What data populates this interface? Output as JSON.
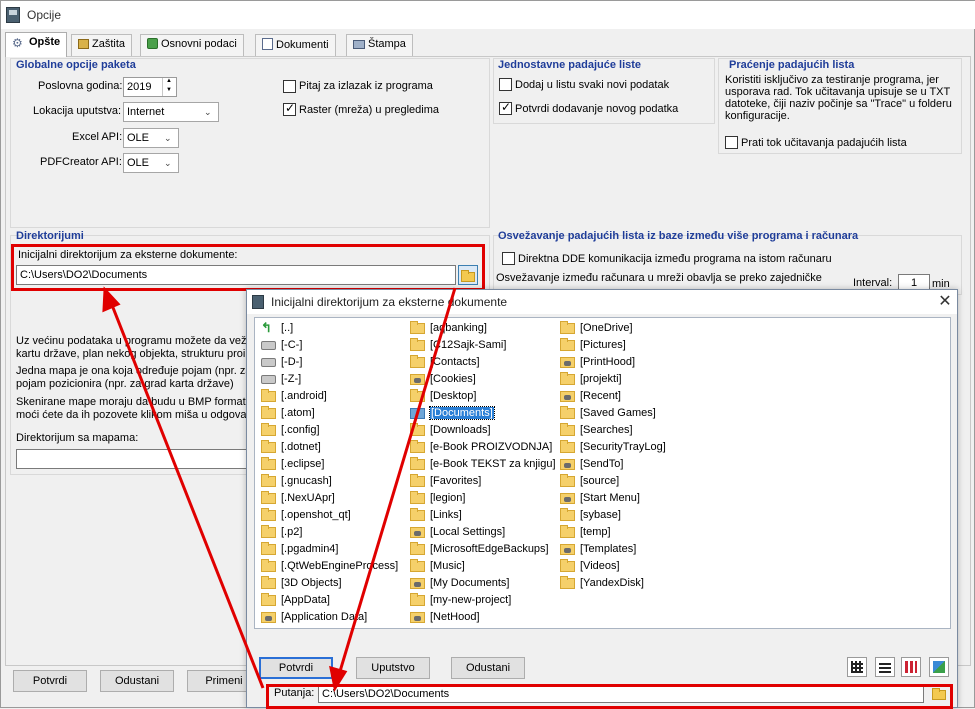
{
  "window": {
    "title": "Opcije"
  },
  "tabs": [
    {
      "label": "Opšte",
      "icon": "gear-icon",
      "active": true
    },
    {
      "label": "Zaštita",
      "icon": "lock-icon"
    },
    {
      "label": "Osnovni podaci",
      "icon": "database-icon"
    },
    {
      "label": "Dokumenti",
      "icon": "documents-icon"
    },
    {
      "label": "Štampa",
      "icon": "printer-icon"
    }
  ],
  "global_options": {
    "title": "Globalne opcije paketa",
    "year_label": "Poslovna godina:",
    "year_value": "2019",
    "help_location_label": "Lokacija uputstva:",
    "help_location_value": "Internet",
    "excel_label": "Excel API:",
    "excel_value": "OLE",
    "pdf_label": "PDFCreator API:",
    "pdf_value": "OLE",
    "ask_exit_label": "Pitaj za izlazak iz programa",
    "ask_exit_checked": false,
    "raster_label": "Raster (mreža) u pregledima",
    "raster_checked": true
  },
  "simple_dropdowns": {
    "title": "Jednostavne padajuće liste",
    "add_new_label": "Dodaj u listu svaki novi podatak",
    "add_new_checked": false,
    "confirm_label": "Potvrdi dodavanje novog podatka",
    "confirm_checked": true
  },
  "tracking": {
    "title": "Praćenje padajućih lista",
    "description": "Koristiti isključivo za testiranje programa, jer usporava rad. Tok učitavanja upisuje se u TXT datoteke, čiji naziv počinje sa \"Trace\" u folderu konfiguracije.",
    "track_label": "Prati tok učitavanja padajućih lista",
    "track_checked": false
  },
  "refresh": {
    "title": "Osvežavanje padajućih lista iz baze između više programa i računara",
    "dde_label": "Direktna DDE komunikacija između programa na istom računaru",
    "dde_checked": false,
    "network_text": "Osvežavanje između računara u mreži obavlja se preko zajedničke",
    "interval_label": "Interval:",
    "interval_value": "1",
    "interval_unit": "min"
  },
  "directories": {
    "title": "Direktorijumi",
    "initial_label": "Inicijalni direktorijum za eksterne dokumente:",
    "initial_value": "C:\\Users\\DO2\\Documents",
    "info1": "Uz većinu podataka u programu možete da veže",
    "info2": "kartu države, plan nekog objekta, strukturu proi",
    "info3": "Jedna mapa je ona koja određuje pojam (npr. za",
    "info4": "pojam pozicionira (npr. za grad karta države)",
    "info5": "Skenirane mape moraju da budu u BMP formatu",
    "info6": "moći ćete da ih pozovete klikom miša u odgovara",
    "maps_label": "Direktorijum sa mapama:",
    "maps_value": ""
  },
  "bottom_buttons": {
    "confirm": "Potvrdi",
    "cancel": "Odustani",
    "apply": "Primeni"
  },
  "dialog": {
    "title": "Inicijalni direktorijum za eksterne dokumente",
    "columns": [
      [
        {
          "name": "[..]",
          "icon": "up-icon"
        },
        {
          "name": "[-C-]",
          "icon": "drive-icon"
        },
        {
          "name": "[-D-]",
          "icon": "drive-icon"
        },
        {
          "name": "[-Z-]",
          "icon": "drive-icon"
        },
        {
          "name": "[.android]",
          "icon": "folder-icon"
        },
        {
          "name": "[.atom]",
          "icon": "folder-icon"
        },
        {
          "name": "[.config]",
          "icon": "folder-icon"
        },
        {
          "name": "[.dotnet]",
          "icon": "folder-icon"
        },
        {
          "name": "[.eclipse]",
          "icon": "folder-icon"
        },
        {
          "name": "[.gnucash]",
          "icon": "folder-icon"
        },
        {
          "name": "[.NexUApr]",
          "icon": "folder-icon"
        },
        {
          "name": "[.openshot_qt]",
          "icon": "folder-icon"
        },
        {
          "name": "[.p2]",
          "icon": "folder-icon"
        },
        {
          "name": "[.pgadmin4]",
          "icon": "folder-icon"
        },
        {
          "name": "[.QtWebEngineProcess]",
          "icon": "folder-icon"
        },
        {
          "name": "[3D Objects]",
          "icon": "folder-icon"
        },
        {
          "name": "[AppData]",
          "icon": "folder-icon"
        },
        {
          "name": "[Application Data]",
          "icon": "folder-link-icon"
        }
      ],
      [
        {
          "name": "[aqbanking]",
          "icon": "folder-icon"
        },
        {
          "name": "[C12Sajk-Sami]",
          "icon": "folder-icon"
        },
        {
          "name": "[Contacts]",
          "icon": "folder-icon"
        },
        {
          "name": "[Cookies]",
          "icon": "folder-link-icon"
        },
        {
          "name": "[Desktop]",
          "icon": "folder-icon"
        },
        {
          "name": "[Documents]",
          "icon": "folder-open-icon",
          "selected": true
        },
        {
          "name": "[Downloads]",
          "icon": "folder-icon"
        },
        {
          "name": "[e-Book PROIZVODNJA]",
          "icon": "folder-icon"
        },
        {
          "name": "[e-Book TEKST za knjigu]",
          "icon": "folder-icon"
        },
        {
          "name": "[Favorites]",
          "icon": "folder-icon"
        },
        {
          "name": "[legion]",
          "icon": "folder-icon"
        },
        {
          "name": "[Links]",
          "icon": "folder-icon"
        },
        {
          "name": "[Local Settings]",
          "icon": "folder-link-icon"
        },
        {
          "name": "[MicrosoftEdgeBackups]",
          "icon": "folder-icon"
        },
        {
          "name": "[Music]",
          "icon": "folder-icon"
        },
        {
          "name": "[My Documents]",
          "icon": "folder-link-icon"
        },
        {
          "name": "[my-new-project]",
          "icon": "folder-icon"
        },
        {
          "name": "[NetHood]",
          "icon": "folder-link-icon"
        }
      ],
      [
        {
          "name": "[OneDrive]",
          "icon": "folder-icon"
        },
        {
          "name": "[Pictures]",
          "icon": "folder-icon"
        },
        {
          "name": "[PrintHood]",
          "icon": "folder-link-icon"
        },
        {
          "name": "[projekti]",
          "icon": "folder-icon"
        },
        {
          "name": "[Recent]",
          "icon": "folder-link-icon"
        },
        {
          "name": "[Saved Games]",
          "icon": "folder-icon"
        },
        {
          "name": "[Searches]",
          "icon": "folder-icon"
        },
        {
          "name": "[SecurityTrayLog]",
          "icon": "folder-icon"
        },
        {
          "name": "[SendTo]",
          "icon": "folder-link-icon"
        },
        {
          "name": "[source]",
          "icon": "folder-icon"
        },
        {
          "name": "[Start Menu]",
          "icon": "folder-link-icon"
        },
        {
          "name": "[sybase]",
          "icon": "folder-icon"
        },
        {
          "name": "[temp]",
          "icon": "folder-icon"
        },
        {
          "name": "[Templates]",
          "icon": "folder-link-icon"
        },
        {
          "name": "[Videos]",
          "icon": "folder-icon"
        },
        {
          "name": "[YandexDisk]",
          "icon": "folder-icon"
        }
      ]
    ],
    "buttons": {
      "confirm": "Potvrdi",
      "help": "Uputstvo",
      "cancel": "Odustani"
    },
    "path_label": "Putanja:",
    "path_value": "C:\\Users\\DO2\\Documents"
  },
  "colors": {
    "group_title": "#1f3d99",
    "highlight": "#e00000",
    "selection": "#2a7fd6"
  }
}
